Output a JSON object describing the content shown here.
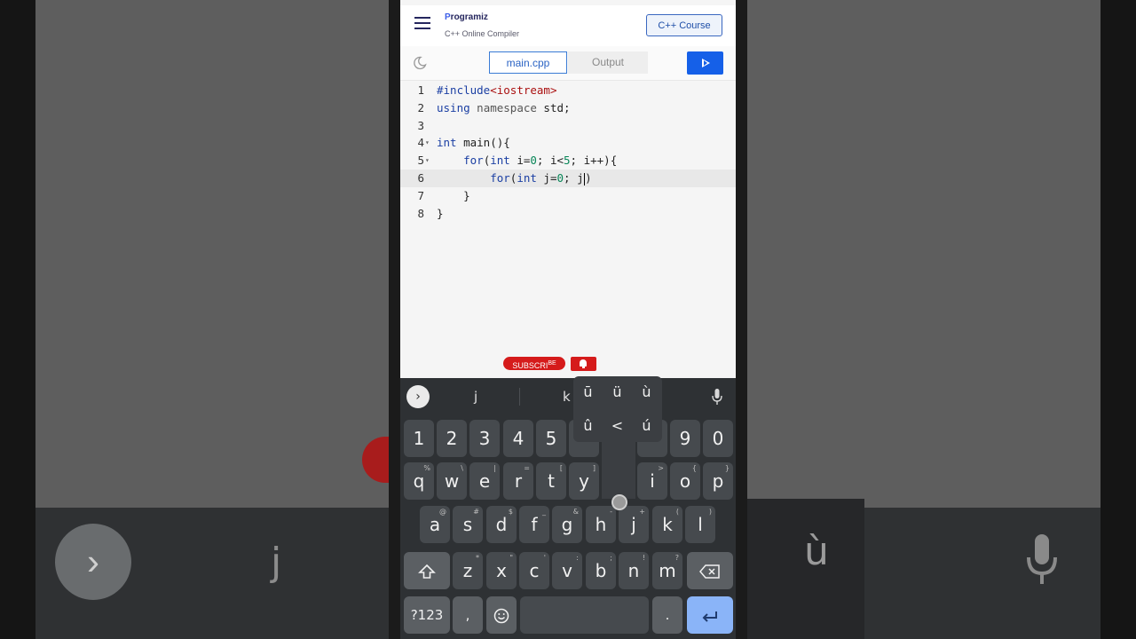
{
  "header": {
    "logo_text": "rogramiz",
    "logo_initial": "P",
    "subtitle": "C++ Online Compiler",
    "course_button": "C++ Course",
    "menu_icon": "hamburger-icon"
  },
  "toolbar": {
    "theme_icon": "moon-icon",
    "tab_main": "main.cpp",
    "tab_output": "Output",
    "run_icon": "play-icon"
  },
  "editor": {
    "lines": [
      {
        "num": "1"
      },
      {
        "num": "2"
      },
      {
        "num": "3"
      },
      {
        "num": "4"
      },
      {
        "num": "5"
      },
      {
        "num": "6"
      },
      {
        "num": "7"
      },
      {
        "num": "8"
      }
    ],
    "code": {
      "l1_include": "#include",
      "l1_header": "<iostream>",
      "l2_using": "using",
      "l2_namespace": " namespace",
      "l2_std": " std;",
      "l4_int": "int",
      "l4_rest": " main(){",
      "l5_for": "for",
      "l5_paren": "(",
      "l5_int": "int",
      "l5_i": " i=",
      "l5_zero": "0",
      "l5_mid": "; i<",
      "l5_five": "5",
      "l5_end": "; i++){",
      "l6_for": "for",
      "l6_paren": "(",
      "l6_int": "int",
      "l6_j": " j=",
      "l6_zero": "0",
      "l6_end": "; j",
      "l6_close": ")",
      "l7": "}",
      "l8": "}"
    }
  },
  "overlay": {
    "subscribe_label": "SUBSCRI",
    "subscribe_sup": "BE",
    "bell_icon": "bell-icon"
  },
  "keyboard": {
    "suggestions": [
      "j",
      "k"
    ],
    "popup_alternates": [
      "ū",
      "ü",
      "ù",
      "û",
      "<",
      "ú"
    ],
    "row_numbers": [
      "1",
      "2",
      "3",
      "4",
      "5",
      "9",
      "0"
    ],
    "row1": [
      {
        "k": "q",
        "h": "%"
      },
      {
        "k": "w",
        "h": "\\"
      },
      {
        "k": "e",
        "h": "|"
      },
      {
        "k": "r",
        "h": "="
      },
      {
        "k": "t",
        "h": "["
      },
      {
        "k": "y",
        "h": "]"
      },
      {
        "k": "i",
        "h": ">"
      },
      {
        "k": "o",
        "h": "{"
      },
      {
        "k": "p",
        "h": "}"
      }
    ],
    "row2": [
      {
        "k": "a",
        "h": "@"
      },
      {
        "k": "s",
        "h": "#"
      },
      {
        "k": "d",
        "h": "$"
      },
      {
        "k": "f",
        "h": "_"
      },
      {
        "k": "g",
        "h": "&"
      },
      {
        "k": "h",
        "h": "-"
      },
      {
        "k": "j",
        "h": "+"
      },
      {
        "k": "k",
        "h": "("
      },
      {
        "k": "l",
        "h": ")"
      }
    ],
    "row3": [
      {
        "k": "z",
        "h": "*"
      },
      {
        "k": "x",
        "h": "\""
      },
      {
        "k": "c",
        "h": "'"
      },
      {
        "k": "v",
        "h": ":"
      },
      {
        "k": "b",
        "h": ";"
      },
      {
        "k": "n",
        "h": "!"
      },
      {
        "k": "m",
        "h": "?"
      }
    ],
    "symbols_key": "?123",
    "comma_key": ",",
    "period_key": ".",
    "shift_icon": "shift-icon",
    "backspace_icon": "backspace-icon",
    "emoji_icon": "emoji-icon",
    "enter_icon": "enter-icon",
    "mic_icon": "mic-icon",
    "expand_icon": "chevron-right-icon"
  },
  "background": {
    "left_letter": "j",
    "right_letter": "ù"
  }
}
